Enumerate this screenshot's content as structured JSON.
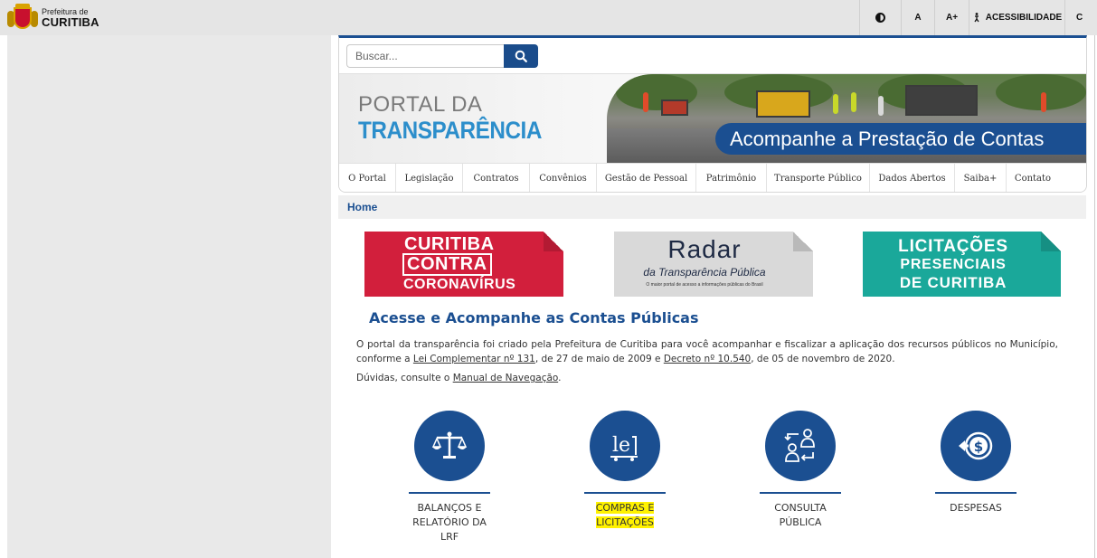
{
  "topbar": {
    "logo_small": "Prefeitura de",
    "logo_big": "CURITIBA",
    "font_small_label": "A",
    "font_large_label": "A+",
    "accessibility_label": "ACESSIBILIDADE",
    "cut_label": "C"
  },
  "search": {
    "placeholder": "Buscar..."
  },
  "banner": {
    "portal_line1": "PORTAL DA",
    "portal_line2": "TRANSPARÊNCIA",
    "caption": "Acompanhe a Prestação de Contas"
  },
  "nav": {
    "items": [
      {
        "label": "O Portal"
      },
      {
        "label": "Legislação"
      },
      {
        "label": "Contratos"
      },
      {
        "label": "Convênios"
      },
      {
        "label": "Gestão de Pessoal"
      },
      {
        "label": "Patrimônio"
      },
      {
        "label": "Transporte Público"
      },
      {
        "label": "Dados Abertos"
      },
      {
        "label": "Saiba+"
      },
      {
        "label": "Contato"
      }
    ]
  },
  "breadcrumb": {
    "home": "Home"
  },
  "promos": {
    "covid": {
      "line1": "CURITIBA",
      "line2": "CONTRA",
      "line3": "CORONAVÍRUS"
    },
    "radar": {
      "title": "Radar",
      "subtitle": "da Transparência Pública",
      "tagline": "O maior portal de acesso a informações públicas do Brasil"
    },
    "licit": {
      "line1": "LICITAÇÕES",
      "line2": "PRESENCIAIS",
      "line3": "DE CURITIBA"
    }
  },
  "content": {
    "title": "Acesse e Acompanhe as Contas Públicas",
    "para_part1": "O portal da transparência foi criado pela Prefeitura de Curitiba para você acompanhar e fiscalizar a aplicação dos recursos públicos no Município, conforme a ",
    "law_link": "Lei Complementar nº 131",
    "para_part2": ", de 27 de maio de 2009 e ",
    "decree_link": "Decreto nº 10.540",
    "para_part3": ", de 05 de novembro de 2020.",
    "doubts_prefix": "Dúvidas, consulte o ",
    "manual_link": "Manual de Navegação",
    "doubts_suffix": "."
  },
  "cards": [
    {
      "label_l1": "BALANÇOS E",
      "label_l2": "RELATÓRIO DA",
      "label_l3": "LRF",
      "icon": "scales-icon"
    },
    {
      "label_l1": "COMPRAS E",
      "label_l2": "LICITAÇÕES",
      "icon": "lei-icon"
    },
    {
      "label_l1": "CONSULTA",
      "label_l2": "PÚBLICA",
      "icon": "people-exchange-icon"
    },
    {
      "label_l1": "DESPESAS",
      "icon": "dollar-coin-icon"
    }
  ],
  "colors": {
    "brand_blue": "#1b4f91",
    "covid_red": "#d21f3c",
    "licit_teal": "#1aa89a",
    "highlight": "#fff200"
  }
}
